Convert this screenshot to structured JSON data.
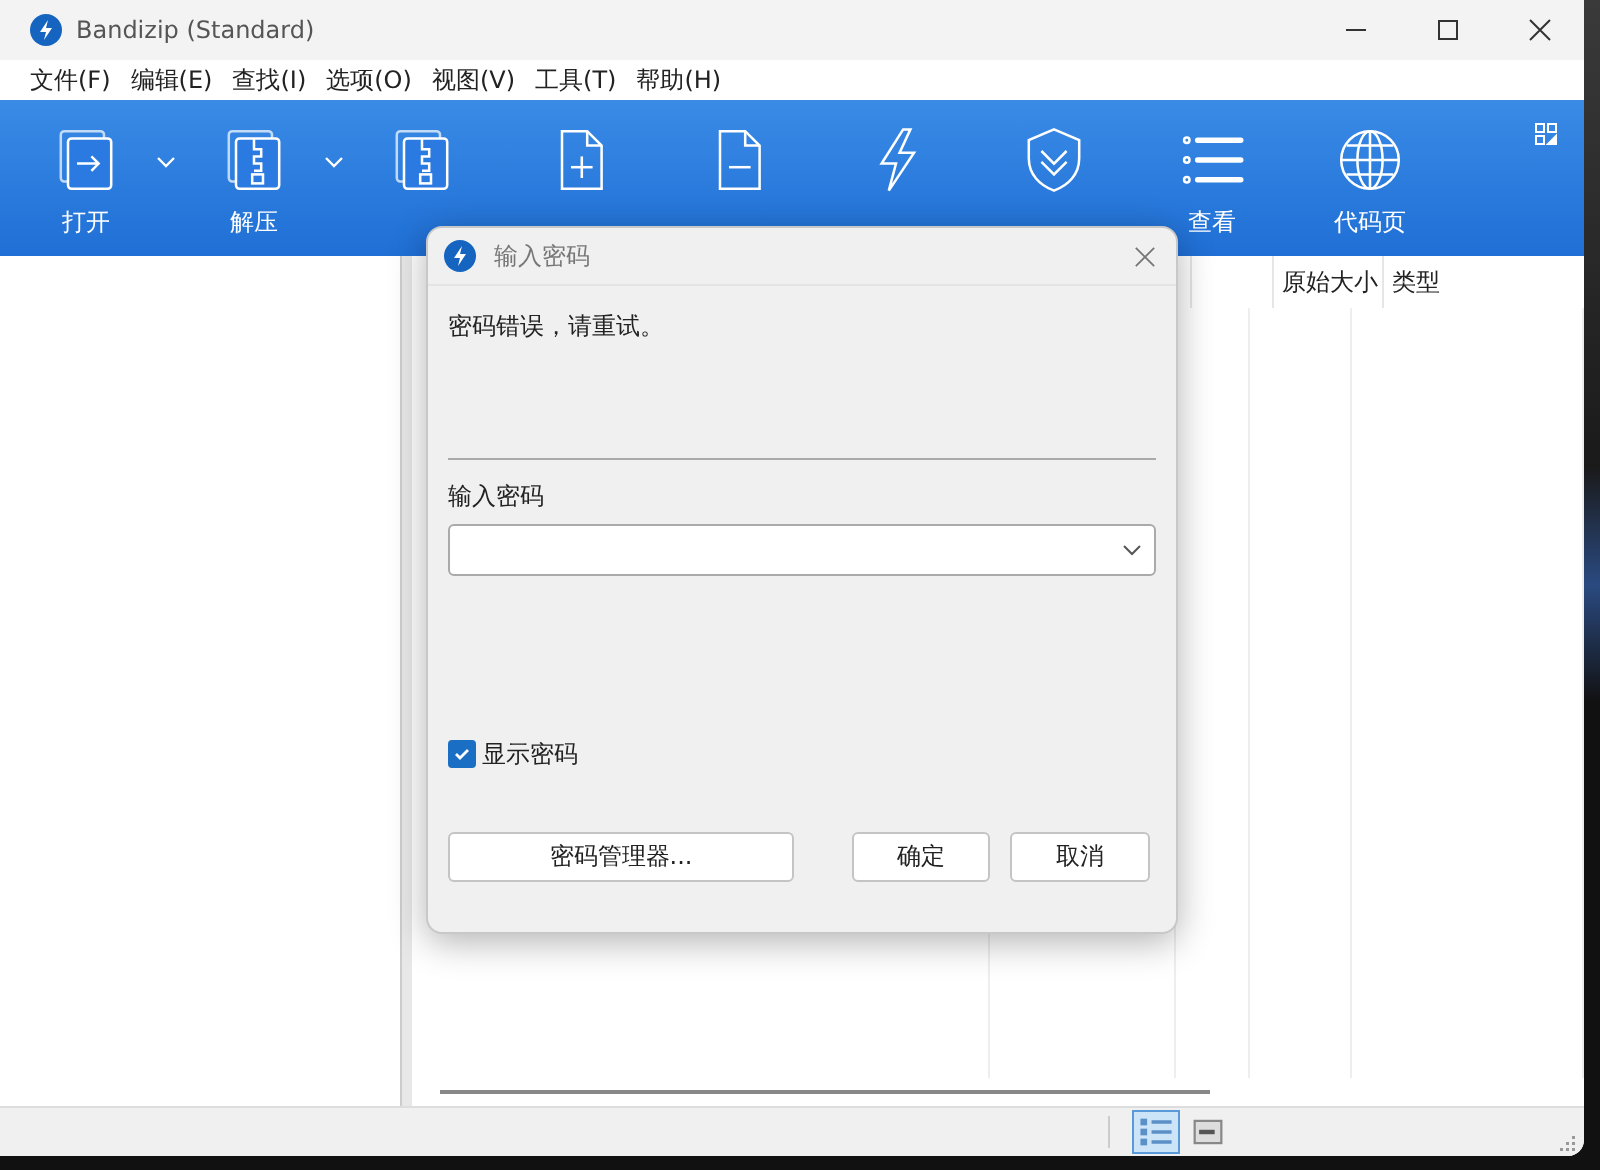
{
  "window": {
    "title": "Bandizip (Standard)"
  },
  "menu": [
    "文件(F)",
    "编辑(E)",
    "查找(I)",
    "选项(O)",
    "视图(V)",
    "工具(T)",
    "帮助(H)"
  ],
  "toolbar": [
    {
      "label": "打开",
      "dropdown": true
    },
    {
      "label": "解压",
      "dropdown": true
    },
    {
      "dropdown": false
    },
    {
      "dropdown": false
    },
    {
      "dropdown": false
    },
    {
      "dropdown": false
    },
    {
      "dropdown": false
    },
    {
      "label": "查看",
      "dropdown": false
    },
    {
      "label": "代码页",
      "dropdown": false
    }
  ],
  "file_list": {
    "columns": [
      "原始大小",
      "类型"
    ]
  },
  "dialog": {
    "title": "输入密码",
    "message": "密码错误，请重试。",
    "password_label": "输入密码",
    "show_password": {
      "label": "显示密码",
      "checked": true
    },
    "buttons": [
      "密码管理器...",
      "确定",
      "取消"
    ]
  },
  "status_bar": {
    "views": [
      {
        "selected": true
      },
      {
        "selected": false
      }
    ]
  }
}
